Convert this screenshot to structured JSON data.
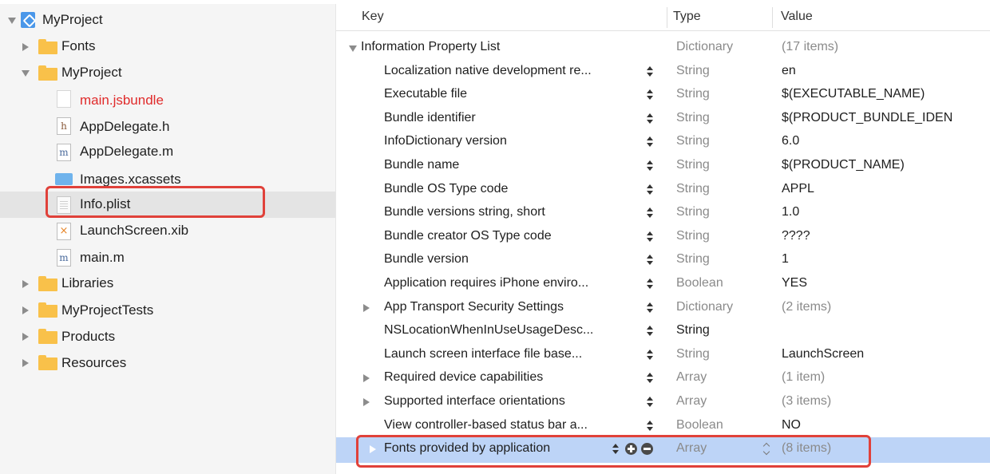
{
  "navigator": {
    "items": [
      {
        "label": "MyProject",
        "icon": "project-icon"
      },
      {
        "label": "Fonts",
        "icon": "folder-icon"
      },
      {
        "label": "MyProject",
        "icon": "folder-icon"
      },
      {
        "label": "main.jsbundle",
        "icon": "file-icon",
        "status": "missing"
      },
      {
        "label": "AppDelegate.h",
        "icon": "header-file-icon",
        "badge": "h"
      },
      {
        "label": "AppDelegate.m",
        "icon": "source-file-icon",
        "badge": "m"
      },
      {
        "label": "Images.xcassets",
        "icon": "asset-catalog-icon"
      },
      {
        "label": "Info.plist",
        "icon": "plist-file-icon",
        "selected": true
      },
      {
        "label": "LaunchScreen.xib",
        "icon": "xib-file-icon",
        "badge": "×"
      },
      {
        "label": "main.m",
        "icon": "source-file-icon",
        "badge": "m"
      },
      {
        "label": "Libraries",
        "icon": "folder-icon"
      },
      {
        "label": "MyProjectTests",
        "icon": "folder-icon"
      },
      {
        "label": "Products",
        "icon": "folder-icon"
      },
      {
        "label": "Resources",
        "icon": "folder-icon"
      }
    ]
  },
  "plist": {
    "columns": {
      "key": "Key",
      "type": "Type",
      "value": "Value"
    },
    "rows": [
      {
        "key": "Information Property List",
        "type": "Dictionary",
        "value": "(17 items)"
      },
      {
        "key": "Localization native development re...",
        "type": "String",
        "value": "en"
      },
      {
        "key": "Executable file",
        "type": "String",
        "value": "$(EXECUTABLE_NAME)"
      },
      {
        "key": "Bundle identifier",
        "type": "String",
        "value": "$(PRODUCT_BUNDLE_IDEN"
      },
      {
        "key": "InfoDictionary version",
        "type": "String",
        "value": "6.0"
      },
      {
        "key": "Bundle name",
        "type": "String",
        "value": "$(PRODUCT_NAME)"
      },
      {
        "key": "Bundle OS Type code",
        "type": "String",
        "value": "APPL"
      },
      {
        "key": "Bundle versions string, short",
        "type": "String",
        "value": "1.0"
      },
      {
        "key": "Bundle creator OS Type code",
        "type": "String",
        "value": "????"
      },
      {
        "key": "Bundle version",
        "type": "String",
        "value": "1"
      },
      {
        "key": "Application requires iPhone enviro...",
        "type": "Boolean",
        "value": "YES"
      },
      {
        "key": "App Transport Security Settings",
        "type": "Dictionary",
        "value": "(2 items)"
      },
      {
        "key": "NSLocationWhenInUseUsageDesc...",
        "type": "String",
        "value": ""
      },
      {
        "key": "Launch screen interface file base...",
        "type": "String",
        "value": "LaunchScreen"
      },
      {
        "key": "Required device capabilities",
        "type": "Array",
        "value": "(1 item)"
      },
      {
        "key": "Supported interface orientations",
        "type": "Array",
        "value": "(3 items)"
      },
      {
        "key": "View controller-based status bar a...",
        "type": "Boolean",
        "value": "NO"
      },
      {
        "key": "Fonts provided by application",
        "type": "Array",
        "value": "(8 items)",
        "selected": true
      }
    ]
  },
  "colors": {
    "selection": "#bdd4f7",
    "annotation": "#e0413a",
    "folder": "#f9c14a",
    "missing_file": "#e02b2b"
  }
}
